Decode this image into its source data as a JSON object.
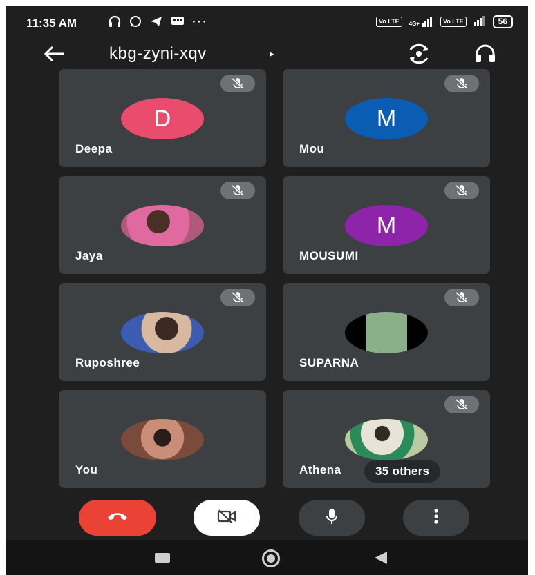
{
  "status": {
    "time": "11:35 AM",
    "left_icons": [
      "headset-icon",
      "whatsapp-icon",
      "telegram-icon",
      "message-icon",
      "more-dots-icon"
    ],
    "sim1": "Vo LTE",
    "network": "4G+",
    "sim2": "Vo LTE",
    "battery": "56"
  },
  "meeting": {
    "code": "kbg-zyni-xqv",
    "caret": "▸"
  },
  "participants": [
    {
      "name": "Deepa",
      "initial": "D",
      "color": "#ea4c6e",
      "photo": false,
      "muted": true
    },
    {
      "name": "Mou",
      "initial": "M",
      "color": "#0b5db3",
      "photo": false,
      "muted": true
    },
    {
      "name": "Jaya",
      "initial": "",
      "color": "#b05a7a",
      "photo": true,
      "muted": true
    },
    {
      "name": "MOUSUMI",
      "initial": "M",
      "color": "#8e24aa",
      "photo": false,
      "muted": true
    },
    {
      "name": "Ruposhree",
      "initial": "",
      "color": "#6a7fb0",
      "photo": true,
      "muted": true
    },
    {
      "name": "SUPARNA",
      "initial": "",
      "color": "#5a8f6a",
      "photo": true,
      "muted": true
    },
    {
      "name": "You",
      "initial": "",
      "color": "#8b5a4a",
      "photo": true,
      "muted": false
    },
    {
      "name": "Athena",
      "initial": "",
      "color": "#7da07a",
      "photo": true,
      "muted": true
    }
  ],
  "others_label": "35 others",
  "controls": [
    "end-call",
    "camera-off",
    "microphone",
    "more-options"
  ]
}
